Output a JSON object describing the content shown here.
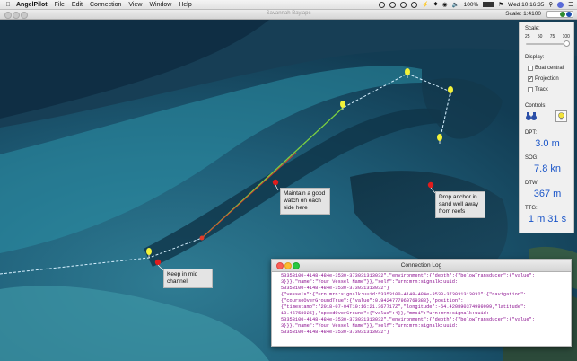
{
  "menubar": {
    "app_name": "AngelPilot",
    "items": [
      "File",
      "Edit",
      "Connection",
      "View",
      "Window",
      "Help"
    ],
    "battery": "100%",
    "clock": "Wed 10:16:35"
  },
  "window": {
    "title": "Savannah Bay.apc",
    "scale_label": "Scale: 1:4100"
  },
  "side_panel": {
    "scale_heading": "Scale:",
    "scale_ticks": [
      "25",
      "50",
      "75",
      "100"
    ],
    "scale_slider_fraction": 0.95,
    "display_heading": "Display:",
    "display_options": [
      {
        "label": "Boat central",
        "checked": false
      },
      {
        "label": "Projection",
        "checked": true
      },
      {
        "label": "Track",
        "checked": false
      }
    ],
    "controls_heading": "Controls:",
    "readouts": [
      {
        "label": "DPT:",
        "value": "3.0 m"
      },
      {
        "label": "SOG:",
        "value": "7.8 kn"
      },
      {
        "label": "DTW:",
        "value": "367 m"
      },
      {
        "label": "TTG:",
        "value": "1 m 31 s"
      }
    ]
  },
  "annotations": [
    {
      "text": [
        "Maintain a good",
        "watch on each",
        "side here"
      ]
    },
    {
      "text": [
        "Drop anchor in",
        "sand well away",
        "from reefs"
      ]
    },
    {
      "text": [
        "Keep in mid",
        "channel"
      ]
    }
  ],
  "log_window": {
    "title": "Connection Log",
    "lines": [
      "53353100-4148-484e-3530-373031313032\",\"environment\":{\"depth\":{\"belowTransducer\":{\"value\":",
      "3}}},\"name\":\"Your Vessel Name\"}},\"self\":\"urn:mrn:signalk:uuid:",
      "53353100-4148-484e-3530-373031313032\"}",
      "{\"vessels\":{\"urn:mrn:signalk:uuid:53353100-4148-484e-3530-373031313032\":{\"navigation\":",
      "{\"courseOverGroundTrue\":{\"value\":0.9424777960769388},\"position\":",
      "{\"timestamp\":\"2018-07-04T10:16:21.367717Z\",\"longitude\":-64.420890374999999,\"latitude\":",
      "18.46758925},\"speedOverGround\":{\"value\":4}},\"mmsi\":\"urn:mrn:signalk:uuid:",
      "53353100-4148-484e-3530-373031313032\",\"environment\":{\"depth\":{\"belowTransducer\":{\"value\":",
      "3}}},\"name\":\"Your Vessel Name\"}},\"self\":\"urn:mrn:signalk:uuid:",
      "53353100-4148-484e-3530-373031313032\"}"
    ]
  },
  "colors": {
    "accent_blue": "#1a55c8",
    "waypoint": "#f2f23a",
    "route": "#d6f0ff",
    "course_line": "#7bd13a",
    "heading_line": "#e03a2a",
    "log_text": "#8a0e8e"
  }
}
